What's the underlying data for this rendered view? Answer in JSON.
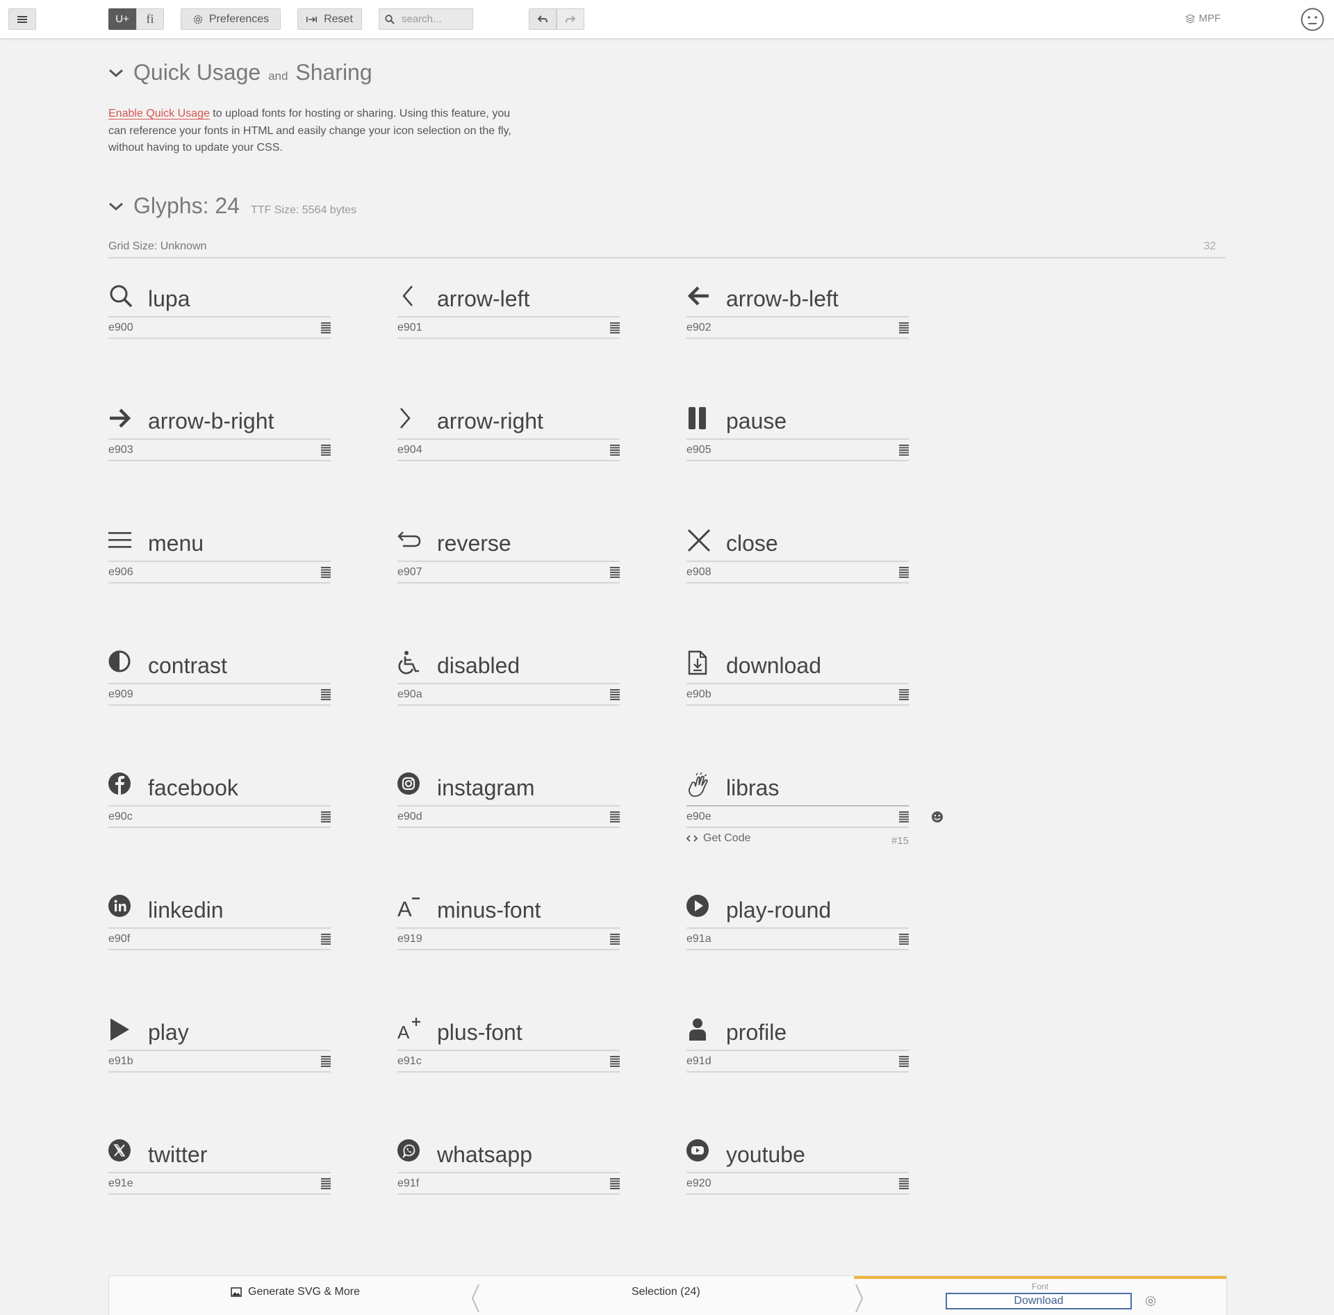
{
  "toolbar": {
    "unicode_toggle": "U+",
    "ligature_toggle": "fi",
    "preferences": "Preferences",
    "reset": "Reset",
    "search_placeholder": "search...",
    "project_name": "MPF"
  },
  "quick_usage": {
    "title_a": "Quick Usage",
    "title_and": "and",
    "title_b": "Sharing",
    "link": "Enable Quick Usage",
    "text": " to upload fonts for hosting or sharing. Using this feature, you can reference your fonts in HTML and easily change your icon selection on the fly, without having to update your CSS."
  },
  "glyphs_section": {
    "title": "Glyphs: 24",
    "ttf_size": "TTF Size: 5564 bytes",
    "grid_size": "Grid Size: Unknown",
    "grid_value": "32"
  },
  "glyphs": [
    {
      "name": "lupa",
      "code": "e900",
      "icon": "search-icon"
    },
    {
      "name": "arrow-left",
      "code": "e901",
      "icon": "chevron-left-icon"
    },
    {
      "name": "arrow-b-left",
      "code": "e902",
      "icon": "arrow-bold-left-icon"
    },
    {
      "name": "arrow-b-right",
      "code": "e903",
      "icon": "arrow-bold-right-icon"
    },
    {
      "name": "arrow-right",
      "code": "e904",
      "icon": "chevron-right-icon"
    },
    {
      "name": "pause",
      "code": "e905",
      "icon": "pause-icon"
    },
    {
      "name": "menu",
      "code": "e906",
      "icon": "hamburger-menu-icon"
    },
    {
      "name": "reverse",
      "code": "e907",
      "icon": "return-arrow-icon"
    },
    {
      "name": "close",
      "code": "e908",
      "icon": "close-x-icon"
    },
    {
      "name": "contrast",
      "code": "e909",
      "icon": "contrast-half-circle-icon"
    },
    {
      "name": "disabled",
      "code": "e90a",
      "icon": "wheelchair-icon"
    },
    {
      "name": "download",
      "code": "e90b",
      "icon": "file-download-icon"
    },
    {
      "name": "facebook",
      "code": "e90c",
      "icon": "facebook-icon"
    },
    {
      "name": "instagram",
      "code": "e90d",
      "icon": "instagram-icon"
    },
    {
      "name": "libras",
      "code": "e90e",
      "icon": "sign-language-hands-icon"
    },
    {
      "name": "linkedin",
      "code": "e90f",
      "icon": "linkedin-icon"
    },
    {
      "name": "minus-font",
      "code": "e919",
      "icon": "font-decrease-icon"
    },
    {
      "name": "play-round",
      "code": "e91a",
      "icon": "play-circle-icon"
    },
    {
      "name": "play",
      "code": "e91b",
      "icon": "play-icon"
    },
    {
      "name": "plus-font",
      "code": "e91c",
      "icon": "font-increase-icon"
    },
    {
      "name": "profile",
      "code": "e91d",
      "icon": "user-profile-icon"
    },
    {
      "name": "twitter",
      "code": "e91e",
      "icon": "x-twitter-icon"
    },
    {
      "name": "whatsapp",
      "code": "e91f",
      "icon": "whatsapp-icon"
    },
    {
      "name": "youtube",
      "code": "e920",
      "icon": "youtube-icon"
    }
  ],
  "selected_glyph": {
    "get_code": "Get Code",
    "index": "#15"
  },
  "bottom_bar": {
    "generate": "Generate SVG & More",
    "selection": "Selection (24)",
    "font_label": "Font",
    "download": "Download"
  },
  "colors": {
    "accent_link": "#d9534f",
    "font_tab_highlight": "#f0b33c",
    "download_border": "#4a6fa5"
  }
}
